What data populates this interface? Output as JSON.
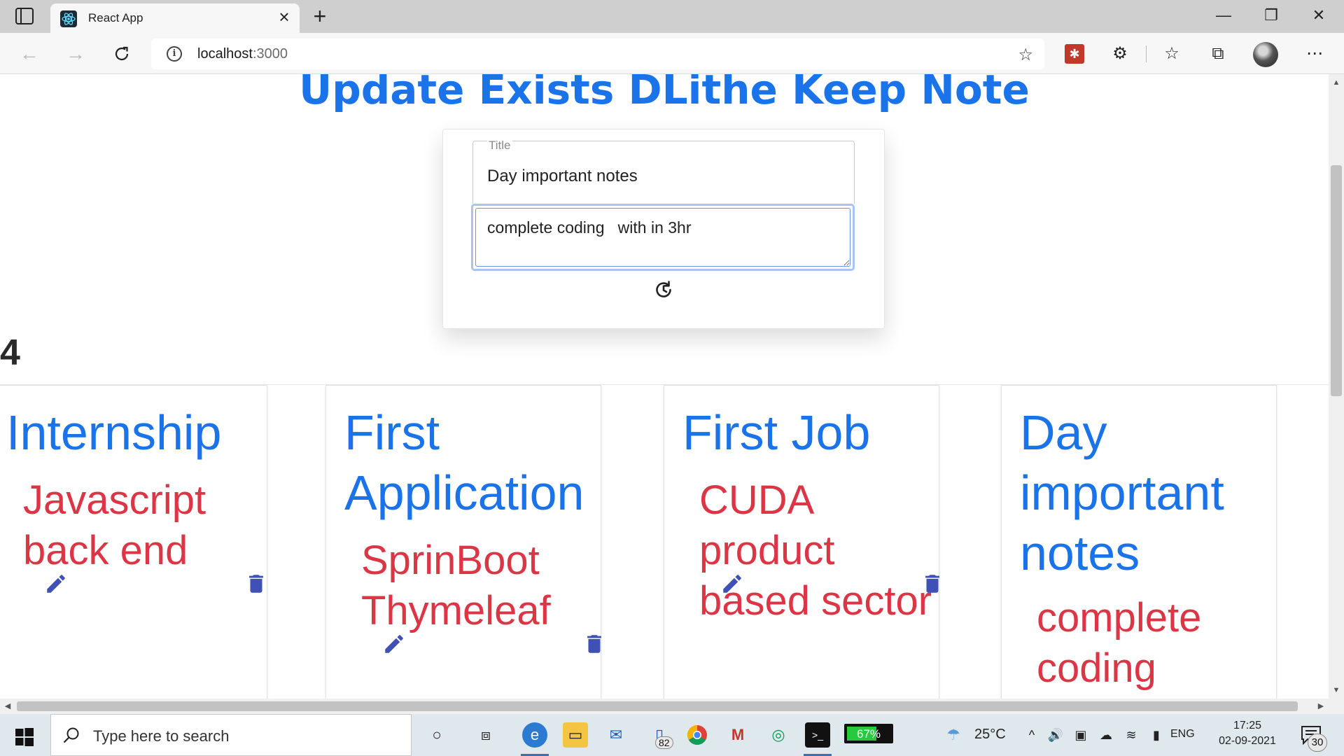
{
  "browser": {
    "tab_title": "React App",
    "url_host": "localhost",
    "url_port": ":3000"
  },
  "page": {
    "heading": "Update Exists DLithe Keep Note",
    "form": {
      "title_label": "Title",
      "title_value": "Day important notes",
      "content_value": "complete coding   with in 3hr"
    },
    "note_count": "4",
    "notes": [
      {
        "title": "Internship",
        "content": "Javascript back end"
      },
      {
        "title": "First Application",
        "content": "SprinBoot Thymeleaf"
      },
      {
        "title": "First Job",
        "content": "CUDA product based sector"
      },
      {
        "title": "Day important notes",
        "content": "complete coding"
      }
    ]
  },
  "taskbar": {
    "search_placeholder": "Type here to search",
    "battery_percent": "67%",
    "battery_level": 0.67,
    "mail_badge": "82",
    "temperature": "25°C",
    "language": "ENG",
    "time": "17:25",
    "date": "02-09-2021",
    "notification_count": "30"
  },
  "colors": {
    "heading_blue": "#1a73e8",
    "note_title_blue": "#1a73e8",
    "note_content_red": "#dc3545",
    "icon_indigo": "#3f51b5"
  }
}
